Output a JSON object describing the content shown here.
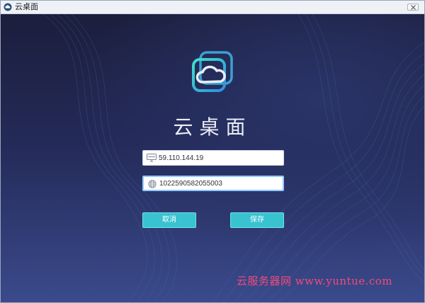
{
  "window": {
    "title": "云桌面",
    "close_label": "close"
  },
  "brand": {
    "name": "云桌面"
  },
  "form": {
    "server_address": {
      "value": "59.110.144.19",
      "icon": "server-icon"
    },
    "client_id": {
      "value": "1022590582055003",
      "icon": "globe-icon"
    }
  },
  "buttons": {
    "cancel_label": "取消",
    "save_label": "保存"
  },
  "watermark": {
    "text": "云服务器网 www.yuntue.com"
  },
  "colors": {
    "background": "#1d2141",
    "accent": "#39c3d1",
    "watermark": "#f24a7a"
  }
}
